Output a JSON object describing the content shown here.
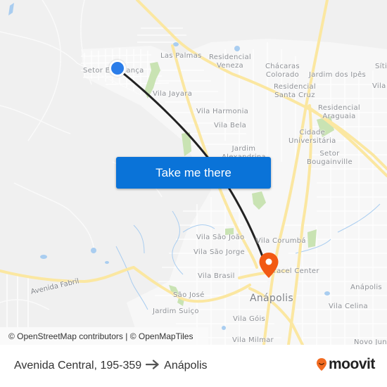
{
  "map": {
    "place_labels": [
      {
        "id": "setor-esperanca",
        "text": "Setor Esperança"
      },
      {
        "id": "las-palmas",
        "text": "Las Palmas"
      },
      {
        "id": "residencial-veneza",
        "text": "Residencial\nVeneza"
      },
      {
        "id": "chacaras-colorado",
        "text": "Chácaras\nColorado"
      },
      {
        "id": "jardim-dos-ipes",
        "text": "Jardim dos Ipês"
      },
      {
        "id": "sitio",
        "text": "Síti"
      },
      {
        "id": "vila-right",
        "text": "Vila"
      },
      {
        "id": "residencial-santa-cruz",
        "text": "Residencial\nSanta Cruz"
      },
      {
        "id": "vila-jayara",
        "text": "Vila Jayara"
      },
      {
        "id": "vila-harmonia",
        "text": "Vila Harmonia"
      },
      {
        "id": "residencial-araguaia",
        "text": "Residencial\nAraguaia"
      },
      {
        "id": "vila-bela",
        "text": "Vila Bela"
      },
      {
        "id": "cidade-universitaria",
        "text": "Cidade\nUniversitária"
      },
      {
        "id": "jardim-alexandrina",
        "text": "Jardim\nAlexandrina"
      },
      {
        "id": "setor-bougainville",
        "text": "Setor\nBougainville"
      },
      {
        "id": "vila-sao-joao",
        "text": "Vila São João"
      },
      {
        "id": "vila-corumba",
        "text": "Vila Corumbá"
      },
      {
        "id": "vila-sao-jorge",
        "text": "Vila São Jorge"
      },
      {
        "id": "vila-brasil",
        "text": "Vila Brasil"
      },
      {
        "id": "jaracel-center",
        "text": "Jaracel Center"
      },
      {
        "id": "anapolis-east",
        "text": "Anápolis"
      },
      {
        "id": "sao-jose",
        "text": "São José"
      },
      {
        "id": "vila-celina",
        "text": "Vila Celina"
      },
      {
        "id": "jardim-suico",
        "text": "Jardim Suiço"
      },
      {
        "id": "vila-gois",
        "text": "Vila Góis"
      },
      {
        "id": "vila-milmar",
        "text": "Vila Milmar"
      },
      {
        "id": "novo-jun",
        "text": "Novo Jun"
      }
    ],
    "city_label": "Anápolis",
    "road_label": "Avenida Fabril",
    "attribution": "© OpenStreetMap contributors | © OpenMapTiles",
    "cta_label": "Take me there",
    "colors": {
      "background": "#f0f0f0",
      "major_road": "#fbe7a1",
      "minor_road": "#ffffff",
      "park": "#c9e3b3",
      "water": "#a9cdf0",
      "route_line": "#222222",
      "origin_marker": "#2b7de9",
      "destination_marker": "#f25a13",
      "cta_background": "#0a73d8"
    }
  },
  "footer": {
    "origin": "Avenida Central, 195-359",
    "arrow_icon": "arrow-right-icon",
    "destination": "Anápolis",
    "brand": "moovit",
    "brand_color": "#f26b21"
  }
}
